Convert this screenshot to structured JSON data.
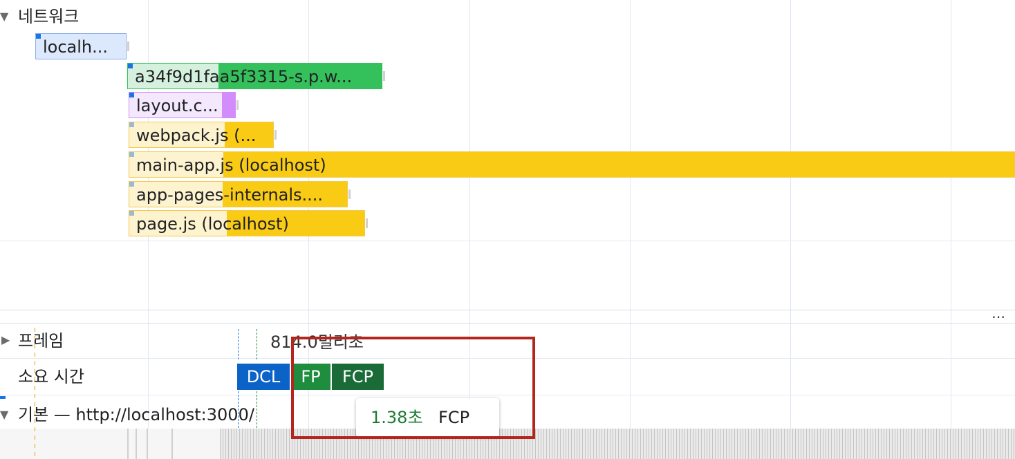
{
  "network": {
    "title": "네트워크",
    "requests": [
      {
        "label": "localh...",
        "wait_color": "#dce8fb",
        "recv_color": "#dce8fb",
        "border": "#8fb0e6",
        "mark_color": "#1a73e8"
      },
      {
        "label": "a34f9d1faa5f3315-s.p.w...",
        "wait_color": "#d5f0dd",
        "recv_color": "#34c05a",
        "border": "#34c05a",
        "mark_color": "#1a73e8"
      },
      {
        "label": "layout.c...",
        "wait_color": "#f3e8fd",
        "recv_color": "#d28dfb",
        "border": "#d28dfb",
        "mark_color": "#1a73e8"
      },
      {
        "label": "webpack.js (...",
        "wait_color": "#fdf3cf",
        "recv_color": "#f9cb14",
        "border": "#f2c94c",
        "mark_color": "#9ab8d8"
      },
      {
        "label": "main-app.js (localhost)",
        "wait_color": "#fdf3cf",
        "recv_color": "#f9cb14",
        "border": "#f2c94c",
        "mark_color": "#9ab8d8"
      },
      {
        "label": "app-pages-internals....",
        "wait_color": "#fdf3cf",
        "recv_color": "#f9cb14",
        "border": "#f2c94c",
        "mark_color": "#9ab8d8"
      },
      {
        "label": "page.js (localhost)",
        "wait_color": "#fdf3cf",
        "recv_color": "#f9cb14",
        "border": "#f2c94c",
        "mark_color": "#9ab8d8"
      }
    ]
  },
  "more_button": "⋯",
  "frames": {
    "title": "프레임",
    "duration": "814.0밀리초"
  },
  "timings": {
    "title": "소요 시간",
    "markers": [
      {
        "label": "DCL",
        "color": "#0b63c8"
      },
      {
        "label": "FP",
        "color": "#1e8e3e"
      },
      {
        "label": "FCP",
        "color": "#1a6b37"
      }
    ]
  },
  "main_thread": {
    "title": "기본 — http://localhost:3000/"
  },
  "tooltip": {
    "time": "1.38초",
    "metric": "FCP",
    "time_color": "#1e7b34"
  },
  "highlight_color": "#b3261e"
}
